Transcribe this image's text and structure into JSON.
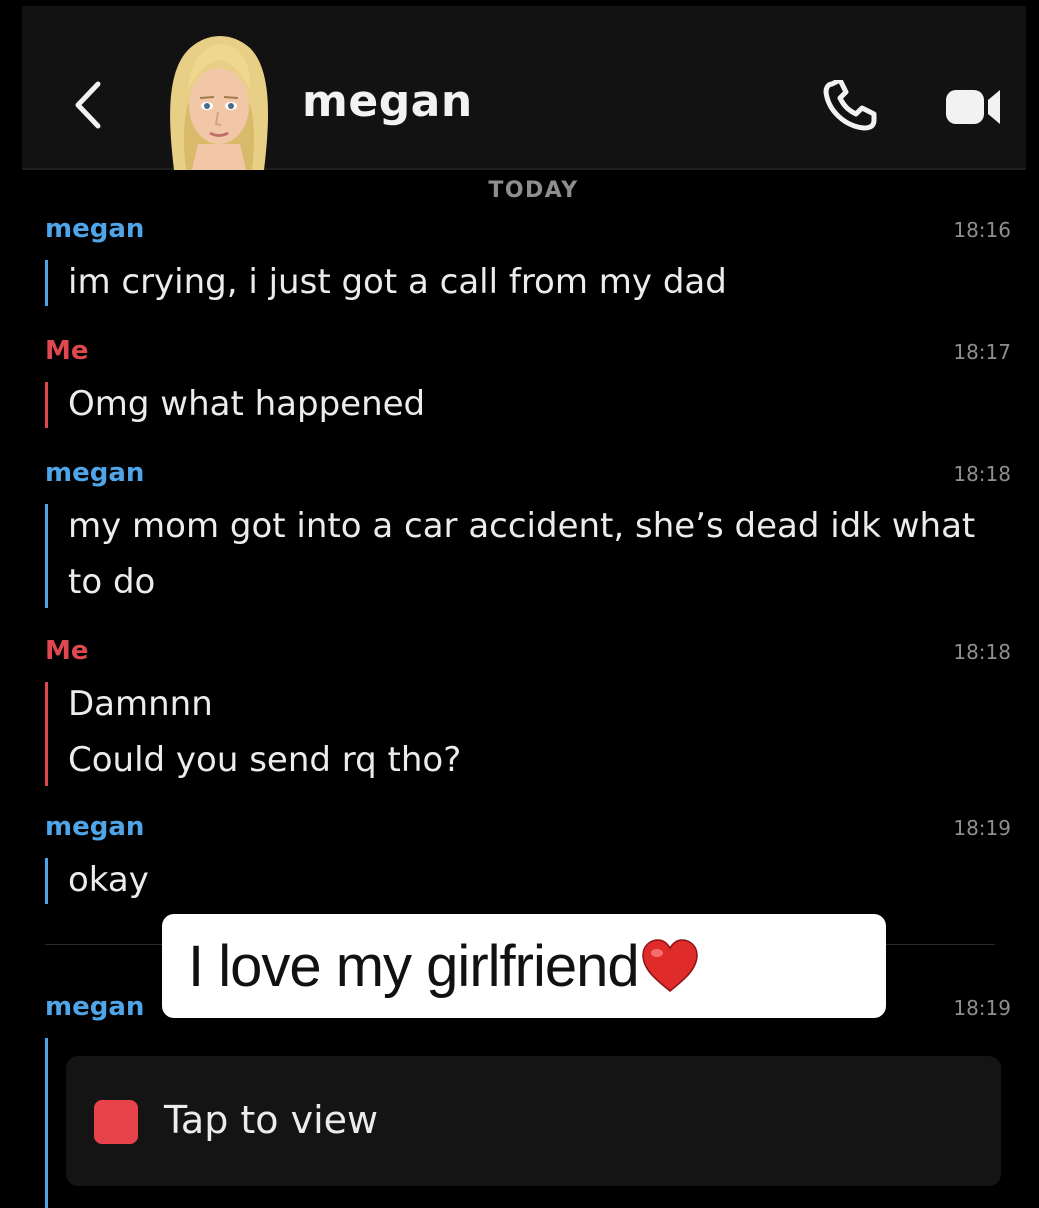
{
  "header": {
    "title": "megan",
    "back_icon": "chevron-left-icon",
    "call_icon": "phone-icon",
    "video_icon": "video-camera-icon",
    "avatar": "bitmoji-avatar"
  },
  "day_label": "TODAY",
  "messages": [
    {
      "sender": "megan",
      "time": "18:16",
      "lines": [
        "im crying, i just got a call from my dad"
      ]
    },
    {
      "sender": "Me",
      "time": "18:17",
      "lines": [
        "Omg what happened"
      ]
    },
    {
      "sender": "megan",
      "time": "18:18",
      "lines": [
        "my mom got into a car accident, she’s dead idk what",
        "to do"
      ]
    },
    {
      "sender": "Me",
      "time": "18:18",
      "lines": [
        "Damnnn",
        "Could you send rq tho?"
      ]
    },
    {
      "sender": "megan",
      "time": "18:19",
      "lines": [
        "okay"
      ]
    },
    {
      "sender": "megan",
      "time": "18:19",
      "lines": []
    }
  ],
  "overlay_caption": "I love my girlfriend",
  "overlay_emoji": "red-heart-icon",
  "snap": {
    "label": "Tap to view"
  },
  "colors": {
    "them": "#4fa5e8",
    "me": "#e0484f",
    "snap": "#e8424b",
    "background": "#000000"
  }
}
